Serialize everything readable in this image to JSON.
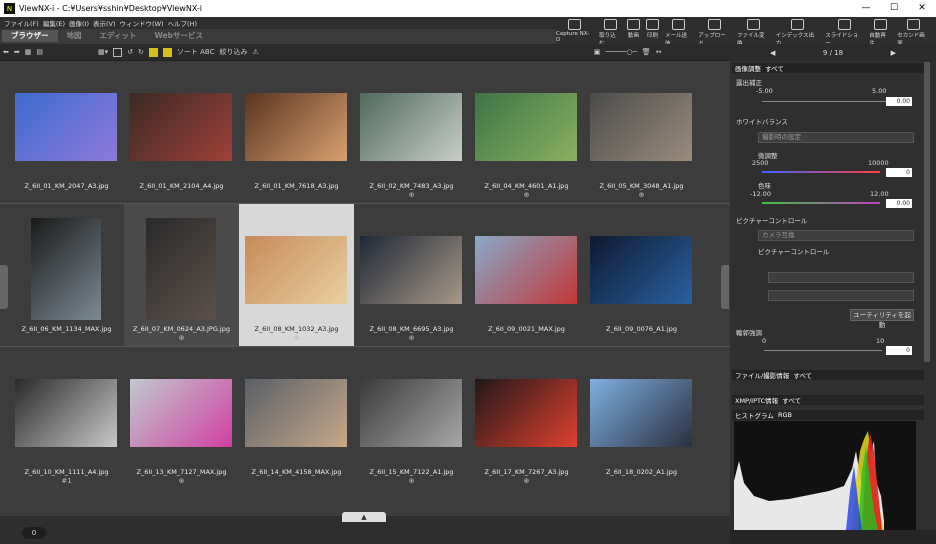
{
  "title": "ViewNX-i - C:¥Users¥sshin¥Desktop¥ViewNX-i",
  "menu": [
    "ファイル(F)",
    "編集(E)",
    "画像(I)",
    "表示(V)",
    "ウィンドウ(W)",
    "ヘルプ(H)"
  ],
  "mode_tabs": [
    "ブラウザー",
    "地図",
    "エディット",
    "Webサービス"
  ],
  "top_tools": [
    {
      "label": "Capture NX-D",
      "icon": "capture-nxd-icon"
    },
    {
      "label": "取り込む",
      "icon": "import-icon"
    },
    {
      "label": "動画",
      "icon": "movie-icon"
    },
    {
      "label": "印刷",
      "icon": "print-icon"
    },
    {
      "label": "メール送信",
      "icon": "mail-icon"
    },
    {
      "label": "アップロード",
      "icon": "upload-icon"
    },
    {
      "label": "ファイル変換",
      "icon": "convert-icon"
    },
    {
      "label": "インデックス出力",
      "icon": "index-icon"
    },
    {
      "label": "スライドショー",
      "icon": "slideshow-icon"
    },
    {
      "label": "自動再生",
      "icon": "autoplay-icon"
    },
    {
      "label": "セカンド画面",
      "icon": "second-screen-icon"
    }
  ],
  "toolbar": {
    "sort": "ソート ABC",
    "filter": "絞り込み"
  },
  "thumbnails": [
    {
      "name": "Z_6II_01_KM_2047_A3.jpg",
      "color1": "#3d6bd0",
      "color2": "#8e7ad8",
      "badge": ""
    },
    {
      "name": "Z_6II_01_KM_2104_A4.jpg",
      "color1": "#3a2a22",
      "color2": "#a0403a",
      "badge": ""
    },
    {
      "name": "Z_6II_01_KM_7618_A3.jpg",
      "color1": "#5a3420",
      "color2": "#d8a070",
      "badge": ""
    },
    {
      "name": "Z_6II_02_KM_7483_A3.jpg",
      "color1": "#4f6a5c",
      "color2": "#c8cec8",
      "badge": "⊕"
    },
    {
      "name": "Z_6II_04_KM_4601_A1.jpg",
      "color1": "#3f7448",
      "color2": "#8ab060",
      "badge": "⊕"
    },
    {
      "name": "Z_6II_05_KM_3048_A1.jpg",
      "color1": "#4b4b4b",
      "color2": "#9a8c7c",
      "badge": "⊕"
    },
    {
      "name": "Z_6II_06_KM_1134_MAX.jpg",
      "color1": "#1a1a1a",
      "color2": "#7c8a94",
      "badge": ""
    },
    {
      "name": "Z_6II_07_KM_0624_A3.JPG.jpg",
      "color1": "#2a2a2a",
      "color2": "#5c504a",
      "badge": "⊕"
    },
    {
      "name": "Z_6II_08_KM_1032_A3.jpg",
      "color1": "#c88a5a",
      "color2": "#e8d0a0",
      "badge": "⊕"
    },
    {
      "name": "Z_6II_08_KM_6695_A3.jpg",
      "color1": "#1e2836",
      "color2": "#a89888",
      "badge": "⊕"
    },
    {
      "name": "Z_6II_09_0021_MAX.jpg",
      "color1": "#8aa8c8",
      "color2": "#c03838",
      "badge": ""
    },
    {
      "name": "Z_6II_09_0076_A1.jpg",
      "color1": "#0e1a30",
      "color2": "#2a60a0",
      "badge": ""
    },
    {
      "name": "Z_6II_10_KM_1111_A4.jpg",
      "color1": "#2a2a2a",
      "color2": "#c8c8c8",
      "badge": "#1"
    },
    {
      "name": "Z_6II_13_KM_7127_MAX.jpg",
      "color1": "#c0c8d0",
      "color2": "#d040a0",
      "badge": "⊕"
    },
    {
      "name": "Z_6II_14_KM_4158_MAX.jpg",
      "color1": "#5a6068",
      "color2": "#c8a888",
      "badge": ""
    },
    {
      "name": "Z_6II_15_KM_7122_A1.jpg",
      "color1": "#3a3a3a",
      "color2": "#a8a8a8",
      "badge": "⊕"
    },
    {
      "name": "Z_6II_17_KM_7267_A3.jpg",
      "color1": "#201818",
      "color2": "#e04030",
      "badge": "⊕"
    },
    {
      "name": "Z_6II_18_0202_A1.jpg",
      "color1": "#80b0e0",
      "color2": "#2a3040",
      "badge": ""
    }
  ],
  "bottom_count": "0",
  "panel": {
    "counter": "9 / 18",
    "image_adjust": {
      "title": "画像調整",
      "scope": "すべて"
    },
    "exposure": {
      "label": "露出補正",
      "min": "-5.00",
      "max": "5.00",
      "value": "0.00"
    },
    "white_balance": {
      "label": "ホワイトバランス",
      "preset": "撮影時の設定"
    },
    "fine_tune": {
      "label": "微調整",
      "min": "2500",
      "max": "10000",
      "value": "0"
    },
    "tint": {
      "label": "色味",
      "min": "-12.00",
      "max": "12.00",
      "value": "0.00"
    },
    "picture_control": {
      "label": "ピクチャーコントロール",
      "preset": "カメラ互換",
      "sub": "ピクチャーコントロール",
      "button": "ユーティリティを起動"
    },
    "sharpness": {
      "label": "輪郭強調",
      "min": "0",
      "max": "10",
      "value": "0"
    },
    "file_info": {
      "title": "ファイル/撮影情報",
      "scope": "すべて"
    },
    "xmp": {
      "title": "XMP/IPTC情報",
      "scope": "すべて"
    },
    "histogram": {
      "title": "ヒストグラム",
      "channel": "RGB"
    }
  }
}
